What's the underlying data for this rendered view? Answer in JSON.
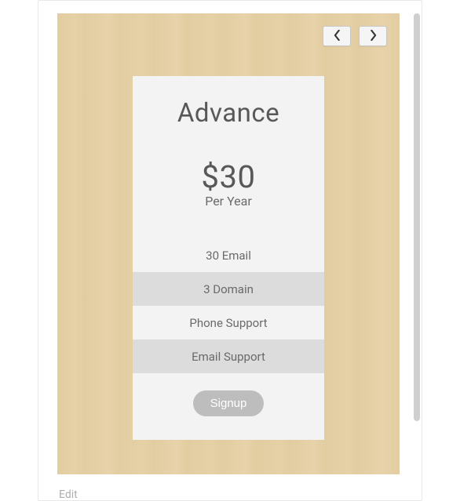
{
  "pricing": {
    "title": "Advance",
    "price": "$30",
    "period": "Per Year",
    "features": [
      "30 Email",
      "3 Domain",
      "Phone Support",
      "Email Support"
    ],
    "cta": "Signup"
  },
  "footer": {
    "edit": "Edit"
  }
}
